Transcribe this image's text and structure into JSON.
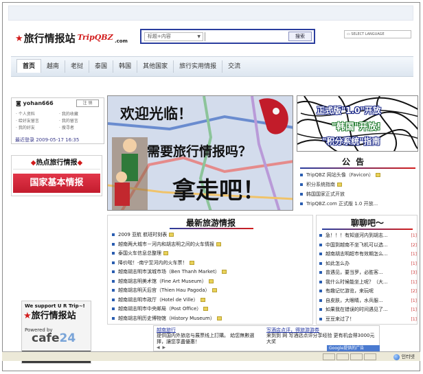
{
  "site": {
    "logo_cn": "旅行情报站",
    "logo_en": "TripQBZ",
    "logo_com": ".com"
  },
  "search": {
    "category": "标题+内容",
    "value": "",
    "button_label": "搜索"
  },
  "language_select": "SELECT LANGUAGE",
  "nav": {
    "items": [
      "首页",
      "越南",
      "老挝",
      "泰国",
      "韩国",
      "其他国家",
      "旅行实用情报",
      "交流"
    ],
    "active": "首页"
  },
  "login": {
    "user": "yohan666",
    "logout_label": "注 销",
    "links": [
      "个人资料",
      "我的收藏",
      "给好友留言",
      "我的留言",
      "我的好友",
      "搜寻者"
    ],
    "last_login": "最近登录  2009-05-17 16:35"
  },
  "hot": {
    "title": "热点旅行情报",
    "banner": "国家基本情报"
  },
  "banner": {
    "line1": "欢迎光临！",
    "line2": "需要旅行情报吗？",
    "line3": "拿走吧！"
  },
  "promo": {
    "line1": "正式版\"1.0\"开放",
    "line2": "\"韩国\"开放!",
    "line3": "\"积分系统\"指南"
  },
  "notice": {
    "title": "公 告",
    "items": [
      {
        "text": "TripQBZ 网站头像（Favicon）",
        "count": ""
      },
      {
        "text": "积分系统指南",
        "count": ""
      },
      {
        "text": "韩国国家正式开放",
        "count": ""
      },
      {
        "text": "TripQBZ.com 正式版 1.0 开放...",
        "count": ""
      }
    ]
  },
  "travel": {
    "title": "最新旅游情报",
    "items": [
      "2009 亚航 航班时刻表",
      "越南两大城市－河内和胡志明之间的火车情报",
      "泰国火车信息总整理",
      "降价啦！-南宁至河内的火车票！",
      "越南胡志明市滨城市场（Ben Thanh Market）",
      "越南胡志明美术馆（Fine Art Museum）",
      "越南胡志明天后宫（Thien Hau Pagoda）",
      "越南胡志明市政厅（Hotel de Ville）",
      "越南胡志明市中央邮局（Post Office）",
      "越南胡志明历史博物馆（History Museum）"
    ]
  },
  "chat": {
    "title": "聊聊吧～",
    "items": [
      {
        "text": "急！！！有知道河内到胡志...",
        "comments": "[1]"
      },
      {
        "text": "中国到越南不坐飞机可以选...",
        "comments": "[2]"
      },
      {
        "text": "越南胡志明超市有效期怎么...",
        "comments": "[1]"
      },
      {
        "text": "如此怎么办",
        "comments": "[1]"
      },
      {
        "text": "曾遇见，要当罗，必胜客...",
        "comments": "[3]"
      },
      {
        "text": "我什么时候能坐上呢？（大...",
        "comments": "[1]"
      },
      {
        "text": "有趣记忆游览，来玩呢",
        "comments": "[2]"
      },
      {
        "text": "自皮肤，大眼睛，水兵服...",
        "comments": "[1]"
      },
      {
        "text": "如果我在错误的时间遇见了...",
        "comments": "[1]"
      },
      {
        "text": "豆豆来过了！",
        "comments": "[1]"
      }
    ]
  },
  "support": {
    "line1": "We support U R Trip~!",
    "line2": "旅行情报站",
    "powered": "Powered by",
    "cafe": "cafe",
    "cafe_num": "24"
  },
  "ads": {
    "ad1_title": "越南旅行",
    "ad1_body": "提供国内外旅店与展票线上訂購。 給您無數選擇，讓您享盡優惠！",
    "ad2_title": "写酒店点评，得旅游游券",
    "ad2_body": "来到到 网 写酒店点评分享经验 更有机会得3000元大奖",
    "pager": "◀ ▶",
    "google": "Google提供的广告"
  },
  "statusbar": {
    "zone": "인터넷"
  }
}
